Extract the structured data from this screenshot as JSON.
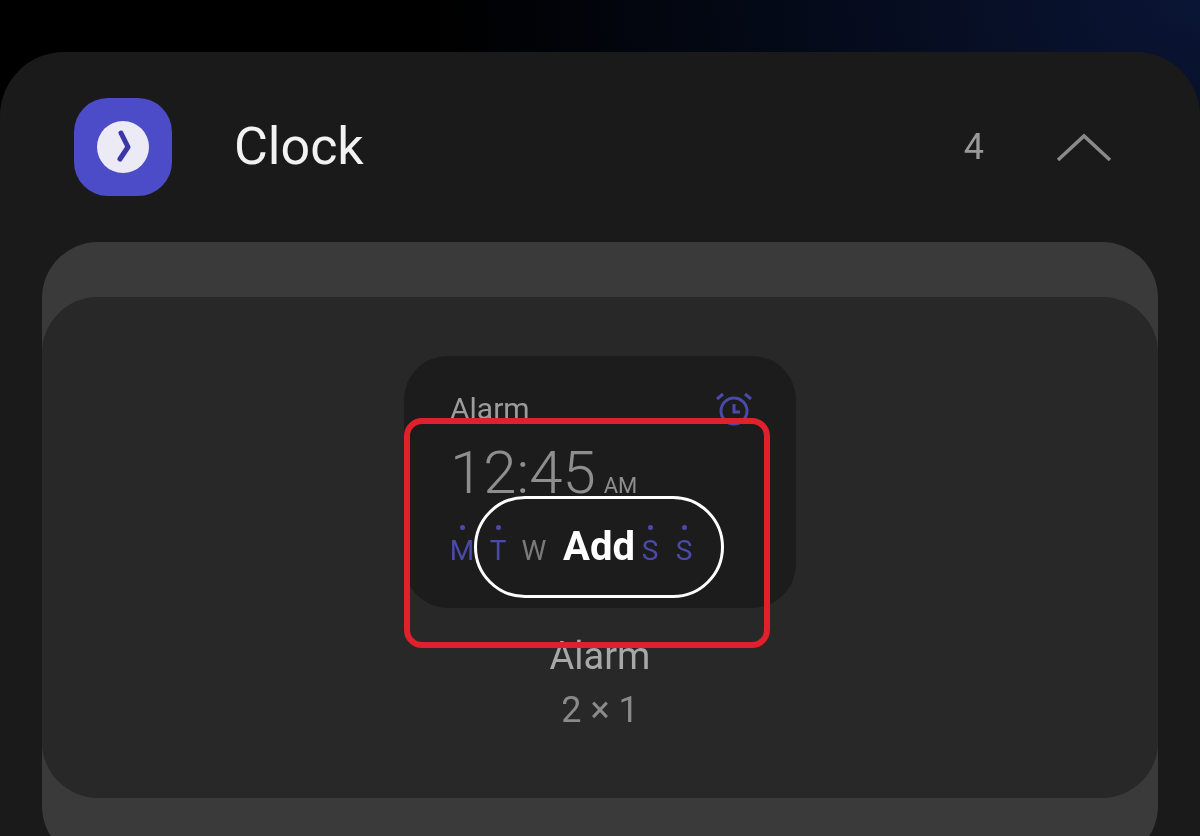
{
  "app": {
    "name": "Clock",
    "count": "4",
    "expanded": true
  },
  "widget": {
    "title": "Alarm",
    "time": "12:45",
    "meridiem": "AM",
    "days": [
      {
        "label": "M",
        "active": true
      },
      {
        "label": "T",
        "active": true
      },
      {
        "label": "W",
        "active": false
      }
    ],
    "days_after_button": [
      {
        "label": "S",
        "active": true
      },
      {
        "label": "S",
        "active": true
      }
    ],
    "add_button": "Add",
    "highlighted": true,
    "name": "Alarm",
    "size": "2 × 1"
  }
}
